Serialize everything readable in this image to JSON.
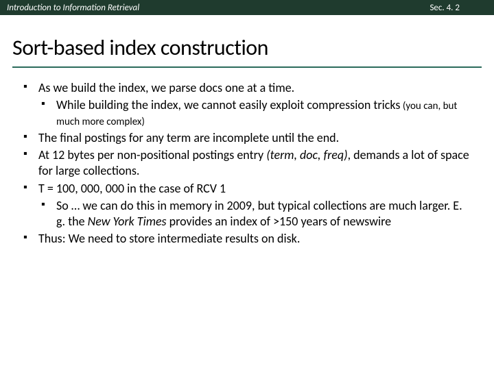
{
  "header": {
    "left": "Introduction to Information Retrieval",
    "right": "Sec. 4. 2"
  },
  "title": "Sort-based index construction",
  "bullets": {
    "b1": "As we build the index, we parse docs one at a time.",
    "b1a_part1": "While building the index, we cannot easily exploit compression tricks",
    "b1a_paren": "  (you can, but much more complex)",
    "b2": "The final postings for any term are incomplete until the end.",
    "b3_part1": "At 12 bytes per non-positional postings entry ",
    "b3_italic": "(term, doc, freq)",
    "b3_part2": ", demands a lot of space for large collections.",
    "b4": "T = 100, 000, 000 in the case of RCV 1",
    "b4a_part1": "So … we can do this in memory in 2009, but typical collections are much larger.  E. g. the ",
    "b4a_italic": "New York Times",
    "b4a_part2": " provides an index of >150 years of newswire",
    "b5": "Thus: We need to store intermediate results on disk."
  }
}
